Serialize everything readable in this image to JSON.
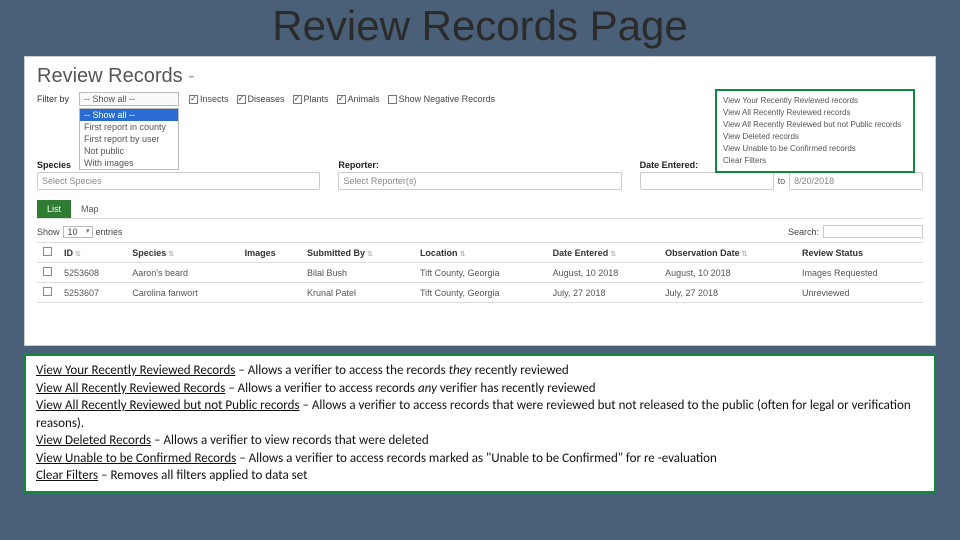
{
  "slide": {
    "title": "Review Records Page"
  },
  "page": {
    "title": "Review Records",
    "dash": " -"
  },
  "filter": {
    "label": "Filter by",
    "dropdown": {
      "current": "-- Show all --",
      "options": [
        "-- Show all --",
        "First report in county",
        "First report by user",
        "Not public",
        "With images"
      ]
    },
    "checks": {
      "insects": "Insects",
      "diseases": "Diseases",
      "plants": "Plants",
      "animals": "Animals",
      "negative": "Show Negative Records"
    }
  },
  "quicklinks": {
    "l0": "View Your Recently Reviewed records",
    "l1": "View All Recently Reviewed records",
    "l2": "View All Recently Reviewed but not Public records",
    "l3": "View Deleted records",
    "l4": "View Unable to be Confirmed records",
    "l5": "Clear Filters"
  },
  "fields": {
    "species": {
      "label": "Species",
      "placeholder": "Select Species"
    },
    "reporter": {
      "label": "Reporter:",
      "placeholder": "Select Reporter(s)"
    },
    "date": {
      "label": "Date Entered:",
      "to": "to",
      "end": "8/20/2018"
    }
  },
  "tabs": {
    "list": "List",
    "map": "Map"
  },
  "table": {
    "show": "Show",
    "entries": "entries",
    "count": "10",
    "search": "Search:",
    "cols": {
      "id": "ID",
      "species": "Species",
      "images": "Images",
      "submitted": "Submitted By",
      "location": "Location",
      "entered": "Date Entered",
      "obs": "Observation Date",
      "status": "Review Status"
    },
    "rows": [
      {
        "id": "5253608",
        "species": "Aaron's beard",
        "images": "",
        "submitted": "Bilal Bush",
        "location": "Tift County, Georgia",
        "entered": "August, 10 2018",
        "obs": "August, 10 2018",
        "status": "Images Requested"
      },
      {
        "id": "5253607",
        "species": "Carolina fanwort",
        "images": "",
        "submitted": "Krunal Patel",
        "location": "Tift County, Georgia",
        "entered": "July, 27 2018",
        "obs": "July, 27 2018",
        "status": "Unreviewed"
      }
    ]
  },
  "legend": {
    "t0": "View Your Recently Reviewed Records",
    "d0a": " – Allows a verifier to access the records ",
    "d0i": "they",
    "d0b": " recently reviewed",
    "t1": "View All Recently Reviewed Records",
    "d1a": " – Allows a verifier to access records ",
    "d1i": "any",
    "d1b": " verifier has recently reviewed",
    "t2": "View All Recently Reviewed but not Public records",
    "d2": " – Allows a verifier to access records that were reviewed but not released to the public (often for legal or verification reasons).",
    "t3": "View Deleted Records",
    "d3": " – Allows a verifier to view records that were deleted",
    "t4": "View Unable to be Confirmed Records",
    "d4": " – Allows a verifier to access records marked as \"Unable to be Confirmed\" for re -evaluation",
    "t5": "Clear Filters",
    "d5": " – Removes all filters applied to data set"
  }
}
